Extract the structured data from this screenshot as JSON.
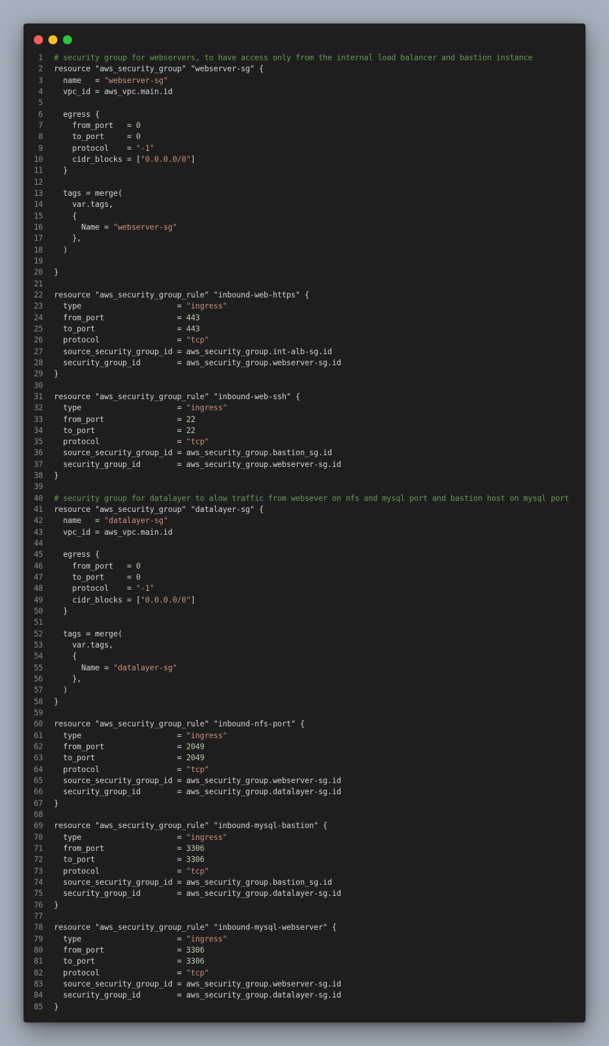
{
  "window": {
    "controls": [
      "close",
      "minimize",
      "zoom"
    ],
    "colors": {
      "background": "#1e1e1e",
      "comment": "#6a9955",
      "string": "#ce9178",
      "number": "#b5cea8",
      "text": "#d4d4d4",
      "line_number": "#8a8a8a"
    }
  },
  "code": {
    "lines": [
      [
        [
          "comment",
          "# security group for webservers, to have access only from the internal load balancer and bastion instance"
        ]
      ],
      [
        [
          "plain",
          "resource \"aws_security_group\" \"webserver-sg\" {"
        ]
      ],
      [
        [
          "plain",
          "  name   = "
        ],
        [
          "string",
          "\"webserver-sg\""
        ]
      ],
      [
        [
          "plain",
          "  vpc_id = aws_vpc.main.id"
        ]
      ],
      [
        [
          "plain",
          ""
        ]
      ],
      [
        [
          "plain",
          "  egress {"
        ]
      ],
      [
        [
          "plain",
          "    from_port   = "
        ],
        [
          "number",
          "0"
        ]
      ],
      [
        [
          "plain",
          "    to_port     = "
        ],
        [
          "number",
          "0"
        ]
      ],
      [
        [
          "plain",
          "    protocol    = "
        ],
        [
          "string",
          "\"-1\""
        ]
      ],
      [
        [
          "plain",
          "    cidr_blocks = ["
        ],
        [
          "string",
          "\"0.0.0.0/0\""
        ],
        [
          "plain",
          "]"
        ]
      ],
      [
        [
          "plain",
          "  }"
        ]
      ],
      [
        [
          "plain",
          ""
        ]
      ],
      [
        [
          "plain",
          "  tags = merge("
        ]
      ],
      [
        [
          "plain",
          "    var.tags,"
        ]
      ],
      [
        [
          "plain",
          "    {"
        ]
      ],
      [
        [
          "plain",
          "      Name = "
        ],
        [
          "string",
          "\"webserver-sg\""
        ]
      ],
      [
        [
          "plain",
          "    },"
        ]
      ],
      [
        [
          "plain",
          "  )"
        ]
      ],
      [
        [
          "plain",
          ""
        ]
      ],
      [
        [
          "plain",
          "}"
        ]
      ],
      [
        [
          "plain",
          ""
        ]
      ],
      [
        [
          "plain",
          "resource \"aws_security_group_rule\" \"inbound-web-https\" {"
        ]
      ],
      [
        [
          "plain",
          "  type                     = "
        ],
        [
          "string",
          "\"ingress\""
        ]
      ],
      [
        [
          "plain",
          "  from_port                = "
        ],
        [
          "number",
          "443"
        ]
      ],
      [
        [
          "plain",
          "  to_port                  = "
        ],
        [
          "number",
          "443"
        ]
      ],
      [
        [
          "plain",
          "  protocol                 = "
        ],
        [
          "string",
          "\"tcp\""
        ]
      ],
      [
        [
          "plain",
          "  source_security_group_id = aws_security_group.int-alb-sg.id"
        ]
      ],
      [
        [
          "plain",
          "  security_group_id        = aws_security_group.webserver-sg.id"
        ]
      ],
      [
        [
          "plain",
          "}"
        ]
      ],
      [
        [
          "plain",
          ""
        ]
      ],
      [
        [
          "plain",
          "resource \"aws_security_group_rule\" \"inbound-web-ssh\" {"
        ]
      ],
      [
        [
          "plain",
          "  type                     = "
        ],
        [
          "string",
          "\"ingress\""
        ]
      ],
      [
        [
          "plain",
          "  from_port                = "
        ],
        [
          "number",
          "22"
        ]
      ],
      [
        [
          "plain",
          "  to_port                  = "
        ],
        [
          "number",
          "22"
        ]
      ],
      [
        [
          "plain",
          "  protocol                 = "
        ],
        [
          "string",
          "\"tcp\""
        ]
      ],
      [
        [
          "plain",
          "  source_security_group_id = aws_security_group.bastion_sg.id"
        ]
      ],
      [
        [
          "plain",
          "  security_group_id        = aws_security_group.webserver-sg.id"
        ]
      ],
      [
        [
          "plain",
          "}"
        ]
      ],
      [
        [
          "plain",
          ""
        ]
      ],
      [
        [
          "comment",
          "# security group for datalayer to alow traffic from websever on nfs and mysql port and bastion host on mysql port"
        ]
      ],
      [
        [
          "plain",
          "resource \"aws_security_group\" \"datalayer-sg\" {"
        ]
      ],
      [
        [
          "plain",
          "  name   = "
        ],
        [
          "string",
          "\"datalayer-sg\""
        ]
      ],
      [
        [
          "plain",
          "  vpc_id = aws_vpc.main.id"
        ]
      ],
      [
        [
          "plain",
          ""
        ]
      ],
      [
        [
          "plain",
          "  egress {"
        ]
      ],
      [
        [
          "plain",
          "    from_port   = "
        ],
        [
          "number",
          "0"
        ]
      ],
      [
        [
          "plain",
          "    to_port     = "
        ],
        [
          "number",
          "0"
        ]
      ],
      [
        [
          "plain",
          "    protocol    = "
        ],
        [
          "string",
          "\"-1\""
        ]
      ],
      [
        [
          "plain",
          "    cidr_blocks = ["
        ],
        [
          "string",
          "\"0.0.0.0/0\""
        ],
        [
          "plain",
          "]"
        ]
      ],
      [
        [
          "plain",
          "  }"
        ]
      ],
      [
        [
          "plain",
          ""
        ]
      ],
      [
        [
          "plain",
          "  tags = merge("
        ]
      ],
      [
        [
          "plain",
          "    var.tags,"
        ]
      ],
      [
        [
          "plain",
          "    {"
        ]
      ],
      [
        [
          "plain",
          "      Name = "
        ],
        [
          "string",
          "\"datalayer-sg\""
        ]
      ],
      [
        [
          "plain",
          "    },"
        ]
      ],
      [
        [
          "plain",
          "  )"
        ]
      ],
      [
        [
          "plain",
          "}"
        ]
      ],
      [
        [
          "plain",
          ""
        ]
      ],
      [
        [
          "plain",
          "resource \"aws_security_group_rule\" \"inbound-nfs-port\" {"
        ]
      ],
      [
        [
          "plain",
          "  type                     = "
        ],
        [
          "string",
          "\"ingress\""
        ]
      ],
      [
        [
          "plain",
          "  from_port                = "
        ],
        [
          "number",
          "2049"
        ]
      ],
      [
        [
          "plain",
          "  to_port                  = "
        ],
        [
          "number",
          "2049"
        ]
      ],
      [
        [
          "plain",
          "  protocol                 = "
        ],
        [
          "string",
          "\"tcp\""
        ]
      ],
      [
        [
          "plain",
          "  source_security_group_id = aws_security_group.webserver-sg.id"
        ]
      ],
      [
        [
          "plain",
          "  security_group_id        = aws_security_group.datalayer-sg.id"
        ]
      ],
      [
        [
          "plain",
          "}"
        ]
      ],
      [
        [
          "plain",
          ""
        ]
      ],
      [
        [
          "plain",
          "resource \"aws_security_group_rule\" \"inbound-mysql-bastion\" {"
        ]
      ],
      [
        [
          "plain",
          "  type                     = "
        ],
        [
          "string",
          "\"ingress\""
        ]
      ],
      [
        [
          "plain",
          "  from_port                = "
        ],
        [
          "number",
          "3306"
        ]
      ],
      [
        [
          "plain",
          "  to_port                  = "
        ],
        [
          "number",
          "3306"
        ]
      ],
      [
        [
          "plain",
          "  protocol                 = "
        ],
        [
          "string",
          "\"tcp\""
        ]
      ],
      [
        [
          "plain",
          "  source_security_group_id = aws_security_group.bastion_sg.id"
        ]
      ],
      [
        [
          "plain",
          "  security_group_id        = aws_security_group.datalayer-sg.id"
        ]
      ],
      [
        [
          "plain",
          "}"
        ]
      ],
      [
        [
          "plain",
          ""
        ]
      ],
      [
        [
          "plain",
          "resource \"aws_security_group_rule\" \"inbound-mysql-webserver\" {"
        ]
      ],
      [
        [
          "plain",
          "  type                     = "
        ],
        [
          "string",
          "\"ingress\""
        ]
      ],
      [
        [
          "plain",
          "  from_port                = "
        ],
        [
          "number",
          "3306"
        ]
      ],
      [
        [
          "plain",
          "  to_port                  = "
        ],
        [
          "number",
          "3306"
        ]
      ],
      [
        [
          "plain",
          "  protocol                 = "
        ],
        [
          "string",
          "\"tcp\""
        ]
      ],
      [
        [
          "plain",
          "  source_security_group_id = aws_security_group.webserver-sg.id"
        ]
      ],
      [
        [
          "plain",
          "  security_group_id        = aws_security_group.datalayer-sg.id"
        ]
      ],
      [
        [
          "plain",
          "}"
        ]
      ]
    ]
  }
}
